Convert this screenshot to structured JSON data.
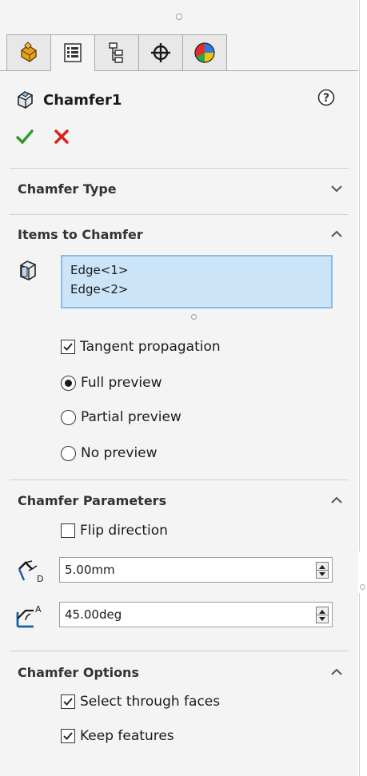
{
  "tabs": [
    {
      "icon": "feature-manager-icon",
      "active": false
    },
    {
      "icon": "property-manager-icon",
      "active": true
    },
    {
      "icon": "configuration-manager-icon",
      "active": false
    },
    {
      "icon": "dimxpert-manager-icon",
      "active": false
    },
    {
      "icon": "display-manager-icon",
      "active": false
    }
  ],
  "header": {
    "title": "Chamfer1",
    "help_icon": "help-icon",
    "ok_icon": "checkmark-icon",
    "cancel_icon": "close-icon",
    "colors": {
      "ok": "#2e9b2e",
      "cancel": "#d9231a"
    }
  },
  "sections": {
    "chamfer_type": {
      "title": "Chamfer Type",
      "collapsed": true
    },
    "items": {
      "title": "Items to Chamfer",
      "list": [
        "Edge<1>",
        "Edge<2>"
      ],
      "tangent_propagation": {
        "label": "Tangent propagation",
        "checked": true
      },
      "preview_options": [
        {
          "label": "Full preview",
          "selected": true
        },
        {
          "label": "Partial preview",
          "selected": false
        },
        {
          "label": "No preview",
          "selected": false
        }
      ]
    },
    "parameters": {
      "title": "Chamfer Parameters",
      "flip_direction": {
        "label": "Flip direction",
        "checked": false
      },
      "distance": "5.00mm",
      "distance_icon_letter": "D",
      "angle": "45.00deg",
      "angle_icon_letter": "A"
    },
    "options": {
      "title": "Chamfer Options",
      "select_through_faces": {
        "label": "Select through faces",
        "checked": true
      },
      "keep_features": {
        "label": "Keep features",
        "checked": true
      }
    }
  },
  "colors": {
    "list_bg": "#cce4f7",
    "list_border": "#88bbe8",
    "panel_bg": "#f4f4f4"
  }
}
